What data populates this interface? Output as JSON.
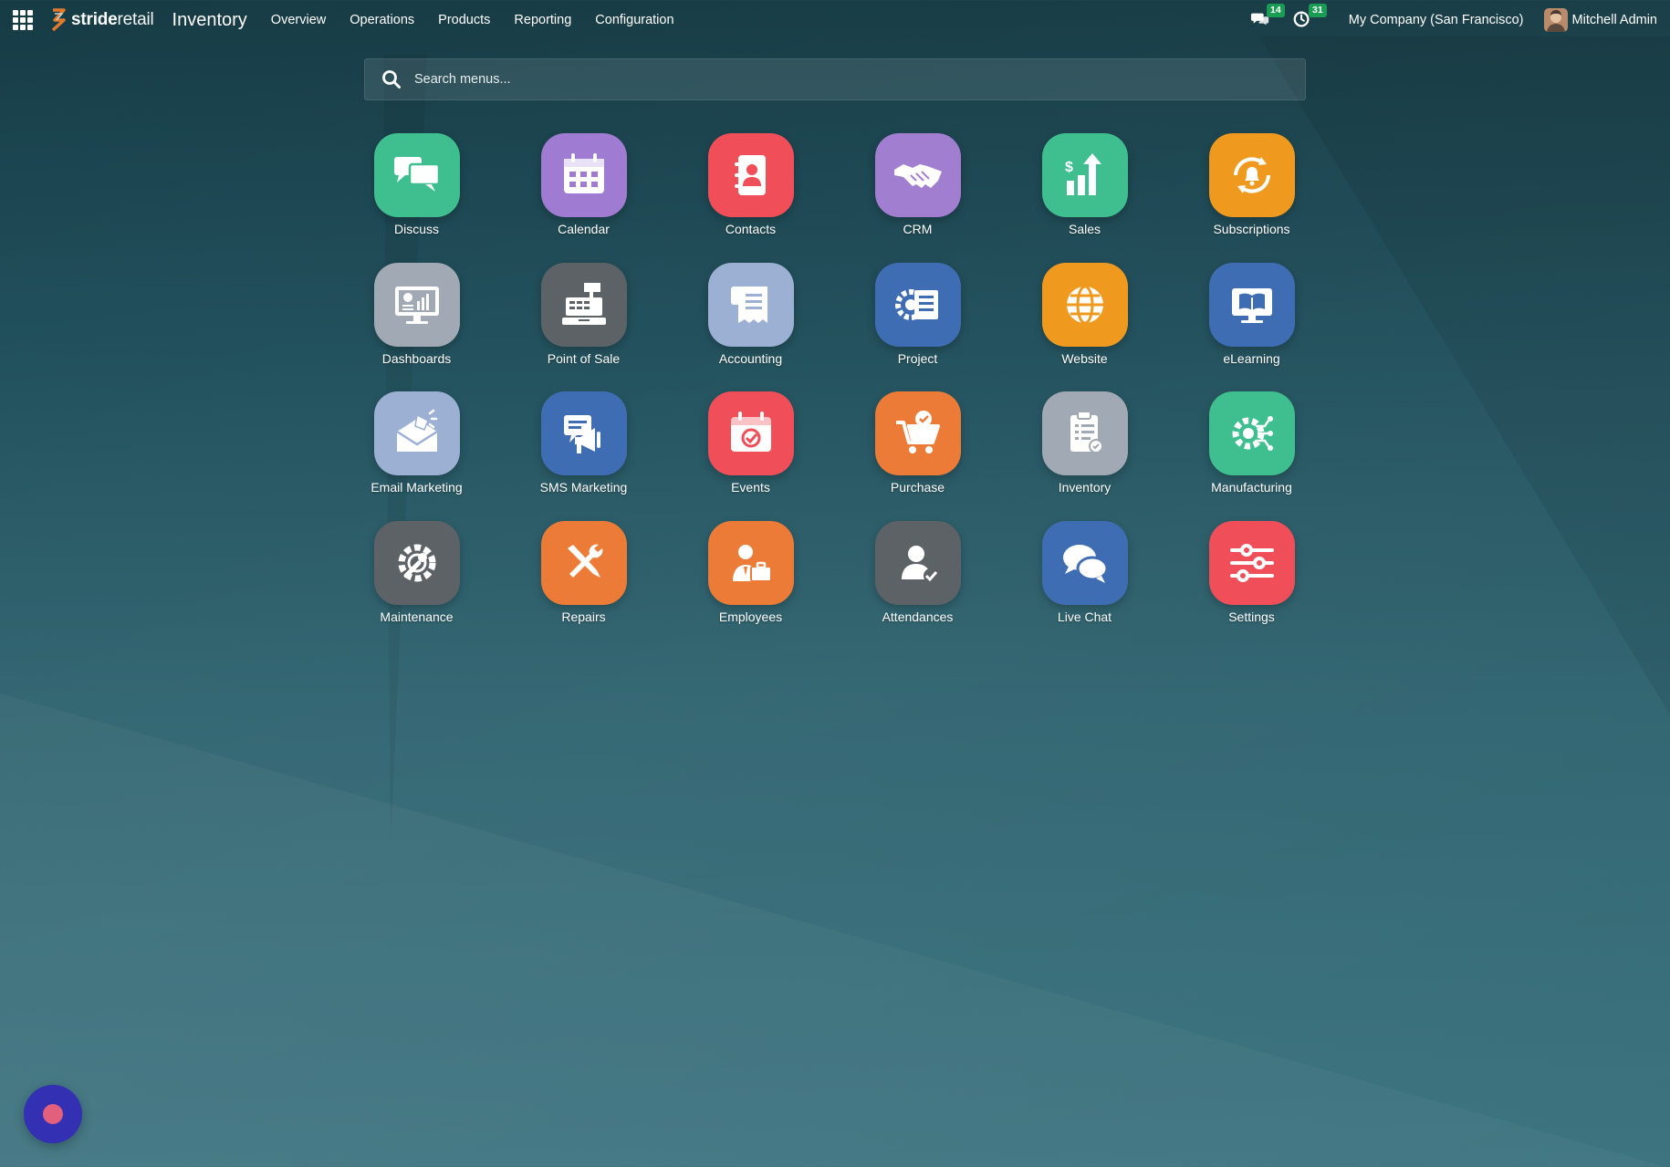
{
  "topbar": {
    "brand_bold": "stride",
    "brand_light": "retail",
    "app_title": "Inventory",
    "nav": [
      "Overview",
      "Operations",
      "Products",
      "Reporting",
      "Configuration"
    ],
    "messages_count": "14",
    "activities_count": "31",
    "company": "My Company (San Francisco)",
    "user_name": "Mitchell Admin"
  },
  "search": {
    "placeholder": "Search menus..."
  },
  "apps": [
    {
      "label": "Discuss",
      "icon": "discuss-icon",
      "color": "#3fbf8f"
    },
    {
      "label": "Calendar",
      "icon": "calendar-icon",
      "color": "#9f7bd1"
    },
    {
      "label": "Contacts",
      "icon": "contacts-icon",
      "color": "#f04f59"
    },
    {
      "label": "CRM",
      "icon": "handshake-icon",
      "color": "#a27ed1"
    },
    {
      "label": "Sales",
      "icon": "sales-chart-icon",
      "color": "#3fbf8f"
    },
    {
      "label": "Subscriptions",
      "icon": "subscriptions-icon",
      "color": "#ef9a1f"
    },
    {
      "label": "Dashboards",
      "icon": "dashboard-icon",
      "color": "#a1a9b4"
    },
    {
      "label": "Point of Sale",
      "icon": "cash-register-icon",
      "color": "#5d6267"
    },
    {
      "label": "Accounting",
      "icon": "accounting-icon",
      "color": "#9cb0d4"
    },
    {
      "label": "Project",
      "icon": "project-icon",
      "color": "#3f6db3"
    },
    {
      "label": "Website",
      "icon": "globe-icon",
      "color": "#ef9a1f"
    },
    {
      "label": "eLearning",
      "icon": "elearning-icon",
      "color": "#3f6db3"
    },
    {
      "label": "Email Marketing",
      "icon": "email-marketing-icon",
      "color": "#9cb0d4"
    },
    {
      "label": "SMS Marketing",
      "icon": "sms-marketing-icon",
      "color": "#3f6db3"
    },
    {
      "label": "Events",
      "icon": "events-icon",
      "color": "#f04f59"
    },
    {
      "label": "Purchase",
      "icon": "purchase-cart-icon",
      "color": "#ec7b37"
    },
    {
      "label": "Inventory",
      "icon": "inventory-clipboard-icon",
      "color": "#a1a9b4"
    },
    {
      "label": "Manufacturing",
      "icon": "manufacturing-gear-icon",
      "color": "#3fbf8f"
    },
    {
      "label": "Maintenance",
      "icon": "maintenance-icon",
      "color": "#5d6267"
    },
    {
      "label": "Repairs",
      "icon": "repairs-tools-icon",
      "color": "#ec7b37"
    },
    {
      "label": "Employees",
      "icon": "employees-icon",
      "color": "#ec7b37"
    },
    {
      "label": "Attendances",
      "icon": "attendances-icon",
      "color": "#5d6267"
    },
    {
      "label": "Live Chat",
      "icon": "live-chat-icon",
      "color": "#3f6db3"
    },
    {
      "label": "Settings",
      "icon": "settings-sliders-icon",
      "color": "#f04f59"
    }
  ]
}
